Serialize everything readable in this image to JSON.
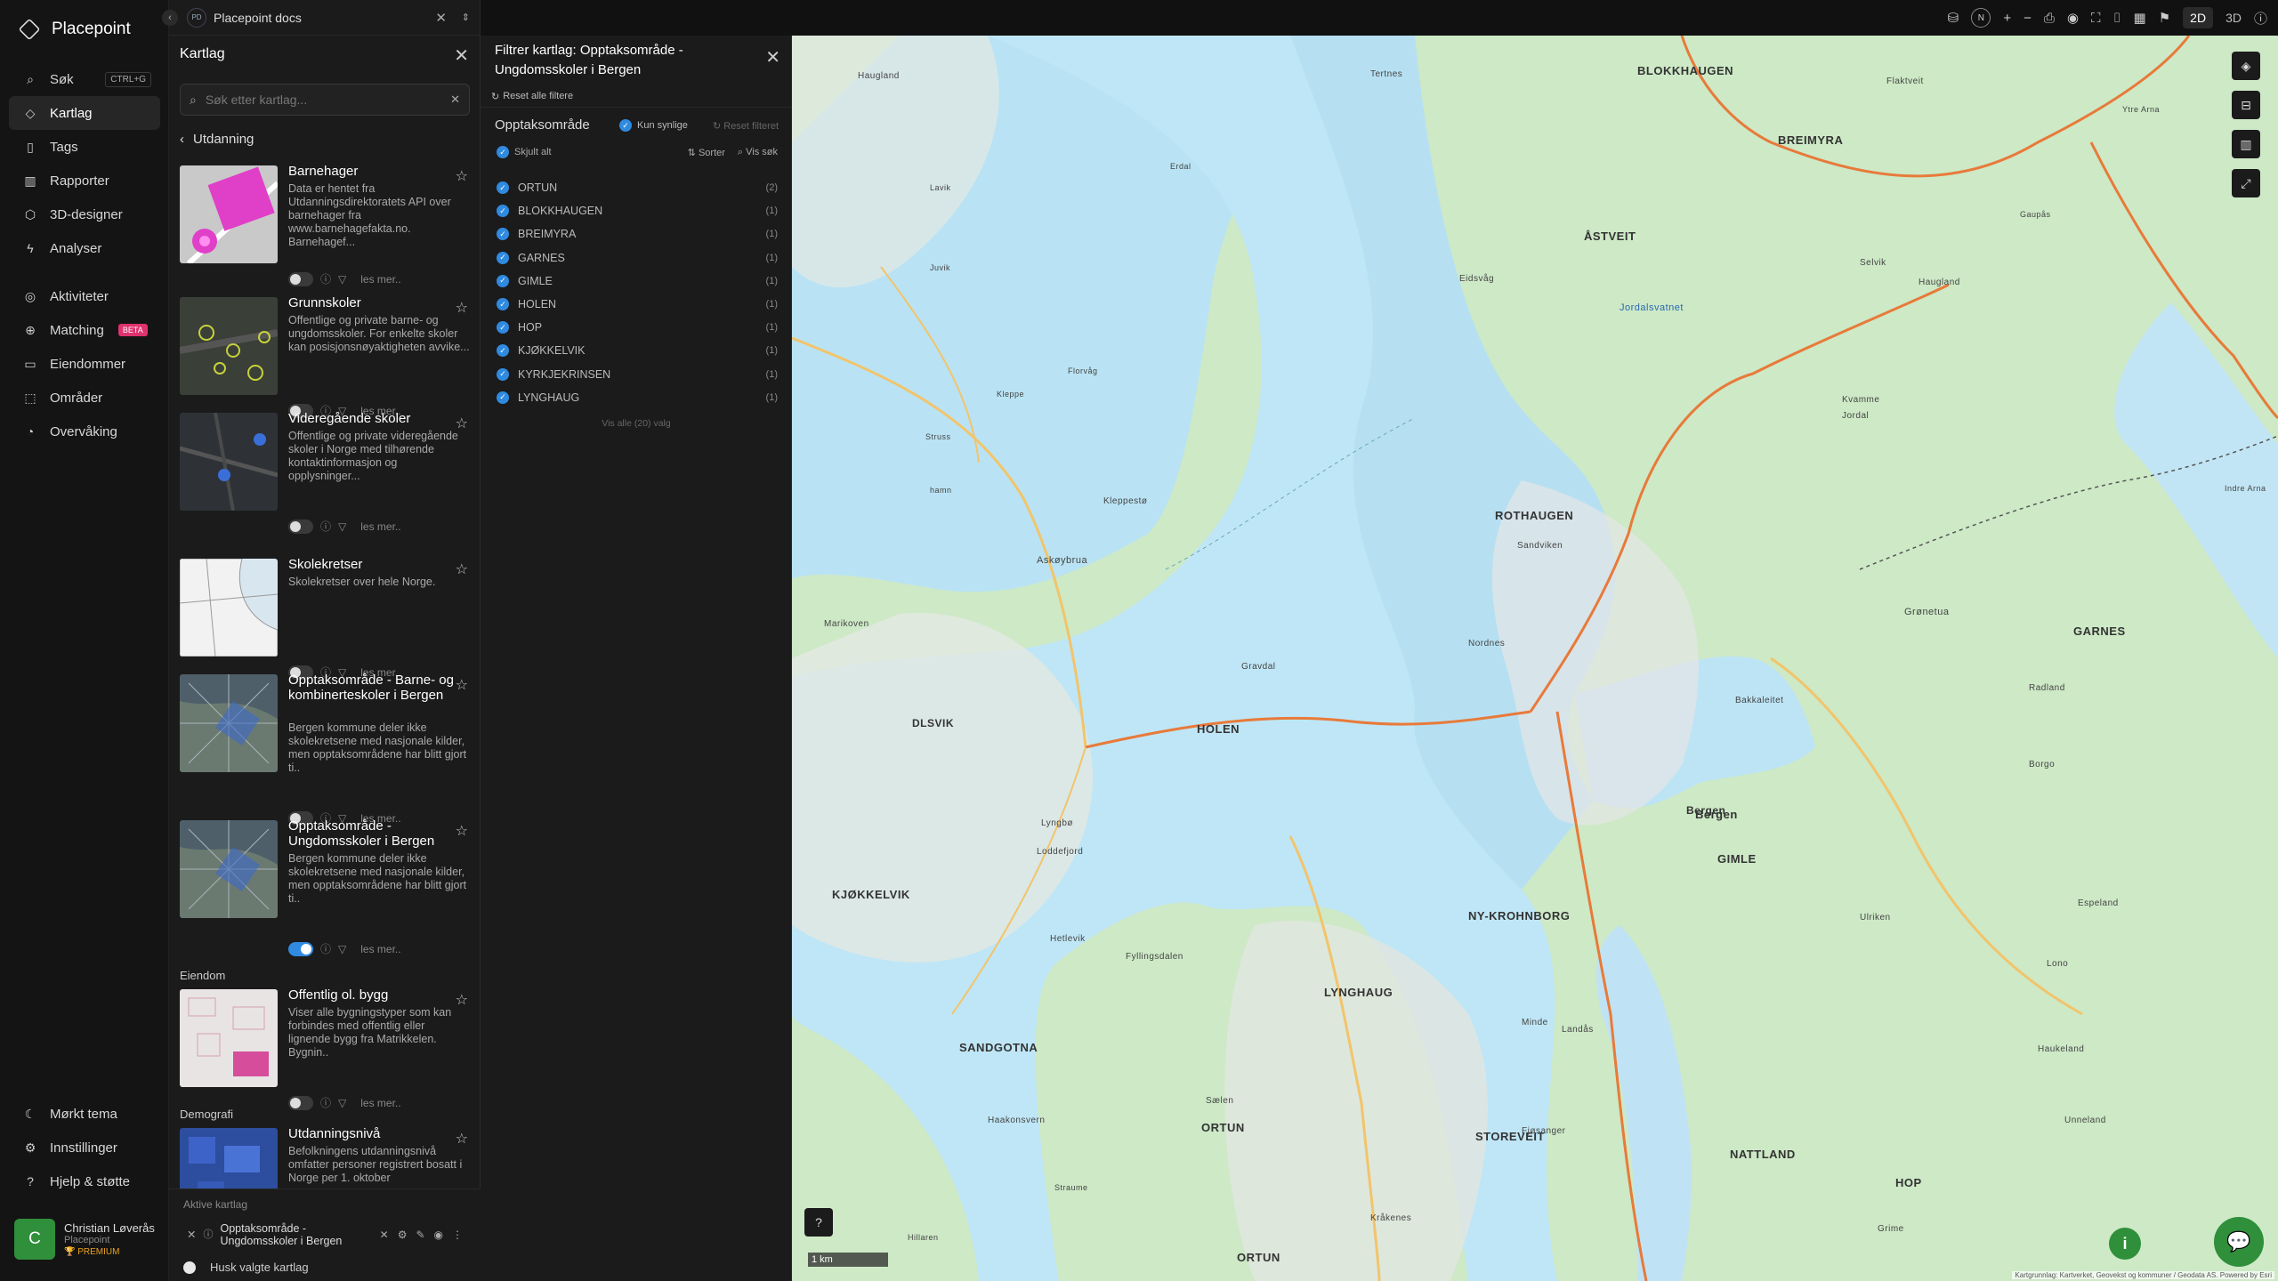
{
  "app": {
    "name": "Placepoint",
    "project_badge": "PD",
    "project": "Placepoint docs"
  },
  "nav": {
    "items": [
      {
        "label": "Søk",
        "icon": "search-icon",
        "kbd": "CTRL+G"
      },
      {
        "label": "Kartlag",
        "icon": "layers-icon",
        "active": true
      },
      {
        "label": "Tags",
        "icon": "bookmark-icon"
      },
      {
        "label": "Rapporter",
        "icon": "chart-icon"
      },
      {
        "label": "3D-designer",
        "icon": "cube-icon"
      },
      {
        "label": "Analyser",
        "icon": "bolt-icon"
      }
    ],
    "items2": [
      {
        "label": "Aktiviteter",
        "icon": "activity-icon"
      },
      {
        "label": "Matching",
        "icon": "matching-icon",
        "badge": "BETA"
      },
      {
        "label": "Eiendommer",
        "icon": "property-icon"
      },
      {
        "label": "Områder",
        "icon": "area-icon"
      },
      {
        "label": "Overvåking",
        "icon": "monitor-icon"
      }
    ],
    "bottom": [
      {
        "label": "Mørkt tema",
        "icon": "moon-icon"
      },
      {
        "label": "Innstillinger",
        "icon": "gear-icon"
      },
      {
        "label": "Hjelp & støtte",
        "icon": "help-icon"
      }
    ],
    "user": {
      "initial": "C",
      "name": "Christian Løverås",
      "company": "Placepoint",
      "plan": "PREMIUM"
    }
  },
  "kartlag": {
    "title": "Kartlag",
    "search_placeholder": "Søk etter kartlag...",
    "breadcrumb": "Utdanning",
    "layers": [
      {
        "title": "Barnehager",
        "desc": "Data er hentet fra Utdanningsdirektoratets API over barnehager fra www.barnehagefakta.no. Barnehagef...",
        "more": "les mer..",
        "on": false,
        "thumb": "barnehage"
      },
      {
        "title": "Grunnskoler",
        "desc": "Offentlige og private barne- og ungdomsskoler. For enkelte skoler kan posisjonsnøyaktigheten avvike...",
        "more": "les mer..",
        "on": false,
        "thumb": "grunn"
      },
      {
        "title": "Videregående skoler",
        "desc": "Offentlige og private videregående skoler i Norge med tilhørende kontaktinformasjon og opplysninger...",
        "more": "les mer..",
        "on": false,
        "thumb": "vgs"
      },
      {
        "title": "Skolekretser",
        "desc": "Skolekretser over hele Norge.",
        "more": "les mer..",
        "on": false,
        "thumb": "krets"
      },
      {
        "title": "Opptaksområde - Barne- og kombinerteskoler i Bergen",
        "desc": "Bergen kommune deler ikke skolekretsene med nasjonale kilder, men opptaksområdene har blitt gjort ti..",
        "more": "les mer..",
        "on": false,
        "thumb": "ortho"
      },
      {
        "title": "Opptaksområde - Ungdomsskoler i Bergen",
        "desc": "Bergen kommune deler ikke skolekretsene med nasjonale kilder, men opptaksområdene har blitt gjort ti..",
        "more": "les mer..",
        "on": true,
        "thumb": "ortho"
      }
    ],
    "section_eiendom": "Eiendom",
    "eiendom_layers": [
      {
        "title": "Offentlig ol. bygg",
        "desc": "Viser alle bygningstyper som kan forbindes med offentlig eller lignende bygg fra Matrikkelen. Bygnin..",
        "more": "les mer..",
        "on": false,
        "thumb": "bygg"
      }
    ],
    "section_demografi": "Demografi",
    "demografi_layers": [
      {
        "title": "Utdanningsnivå",
        "desc": "Befolkningens utdanningsnivå omfatter personer registrert bosatt i Norge per 1. oktober",
        "thumb": "utd"
      }
    ],
    "aktive_label": "Aktive kartlag",
    "aktive_item": "Opptaksområde - Ungdomsskoler i Bergen",
    "husk": "Husk valgte kartlag"
  },
  "filter": {
    "title": "Filtrer kartlag: Opptaksområde - Ungdomsskoler i Bergen",
    "reset_all": "Reset alle filtere",
    "field": "Opptaksområde",
    "only_visible": "Kun synlige",
    "reset_filter": "Reset filteret",
    "hide_all": "Skjult alt",
    "sort": "Sorter",
    "show_search": "Vis søk",
    "items": [
      {
        "name": "ORTUN",
        "count": "(2)"
      },
      {
        "name": "BLOKKHAUGEN",
        "count": "(1)"
      },
      {
        "name": "BREIMYRA",
        "count": "(1)"
      },
      {
        "name": "GARNES",
        "count": "(1)"
      },
      {
        "name": "GIMLE",
        "count": "(1)"
      },
      {
        "name": "HOLEN",
        "count": "(1)"
      },
      {
        "name": "HOP",
        "count": "(1)"
      },
      {
        "name": "KJØKKELVIK",
        "count": "(1)"
      },
      {
        "name": "KYRKJEKRINSEN",
        "count": "(1)"
      },
      {
        "name": "LYNGHAUG",
        "count": "(1)"
      }
    ],
    "show_all": "Vis alle (20) valg"
  },
  "topbar": {
    "compass": "N",
    "mode2d": "2D",
    "mode3d": "3D"
  },
  "map": {
    "scale": "1 km",
    "attribution": "Kartgrunnlag: Kartverket, Geovekst og kommuner / Geodata AS. Powered by Esri",
    "places": [
      "BLOKKHAUGEN",
      "BREIMYRA",
      "ÅSTVEIT",
      "ROTHAUGEN",
      "GARNES",
      "HOLEN",
      "DLSVIK",
      "Bergen",
      "GIMLE",
      "KJØKKELVIK",
      "NY-KROHNBORG",
      "LYNGHAUG",
      "SANDGOTNA",
      "ORTUN",
      "STOREVEIT",
      "NATTLAND",
      "HOP",
      "ORTUN",
      "Askøybrua",
      "Marikoven",
      "Kleppestø",
      "Jordalsvatnet",
      "Haugland",
      "Tertnes",
      "Flaktveit",
      "Eidsvåg",
      "Sandviken",
      "Kvamme",
      "Selvik",
      "Grønetua",
      "Ulriken",
      "Radland",
      "Borgo",
      "Espeland",
      "Lono",
      "Haukeland",
      "Unneland",
      "Fyllingsdalen",
      "Lyngbø",
      "Loddefjord",
      "Hetlevik",
      "Sælen",
      "Haakonsvern",
      "Landås",
      "Minde",
      "Fjøsanger",
      "Kråkenes",
      "Straume",
      "Hillaren",
      "Gravdal",
      "Nordnes",
      "Lavik",
      "Juvik",
      "Erdal",
      "Florvåg",
      "Kleppe",
      "hamn",
      "Struss",
      "Gaupås",
      "Ytre Arna",
      "Indre Arna",
      "Bergen",
      "Bakkaleitet",
      "Grime",
      "Jordal",
      "Haugland"
    ]
  }
}
